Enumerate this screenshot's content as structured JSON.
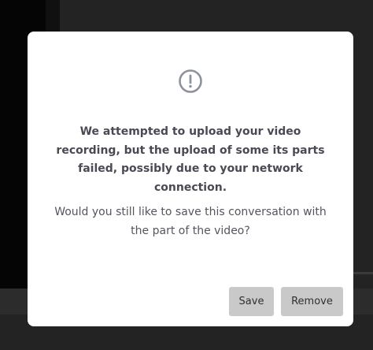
{
  "dialog": {
    "icon": "exclamation-circle-icon",
    "headline_lines": [
      "We attempted to upload your video",
      "recording, but the upload of some its parts",
      "failed, possibly due to your network",
      "connection."
    ],
    "question_lines": [
      "Would you still like to save this conversation with",
      "the part of the video?"
    ],
    "buttons": {
      "save_label": "Save",
      "remove_label": "Remove"
    }
  },
  "colors": {
    "icon_stroke": "#8e929c",
    "headline_text": "#4a4a54",
    "body_text": "#55555f",
    "button_bg": "#c9c9c9",
    "overlay_bg": "#1b1b1b"
  }
}
